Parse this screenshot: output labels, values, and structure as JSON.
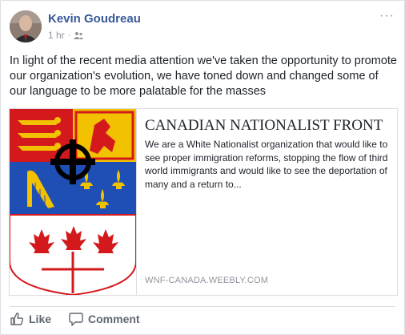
{
  "post": {
    "author": "Kevin Goudreau",
    "timestamp": "1 hr",
    "separator": "·",
    "privacy_icon": "friends-icon",
    "more_label": "···",
    "text": "In light of the recent media attention we've taken the opportunity to promote our organization's evolution, we have toned down and changed some of our language to be more palatable for the masses"
  },
  "shared_link": {
    "title": "CANADIAN NATIONALIST FRONT",
    "description": "We are a White Nationalist organization that would like to see proper immigration reforms, stopping the flow of third world immigrants and would like to see the deportation of many and a return to...",
    "domain": "WNF-CANADA.WEEBLY.COM",
    "image_icon": "coat-of-arms-image"
  },
  "actions": {
    "like_label": "Like",
    "comment_label": "Comment"
  },
  "colors": {
    "author_link": "#385898",
    "secondary_text": "#90949c",
    "body_text": "#1d2129",
    "action_text": "#606770"
  }
}
